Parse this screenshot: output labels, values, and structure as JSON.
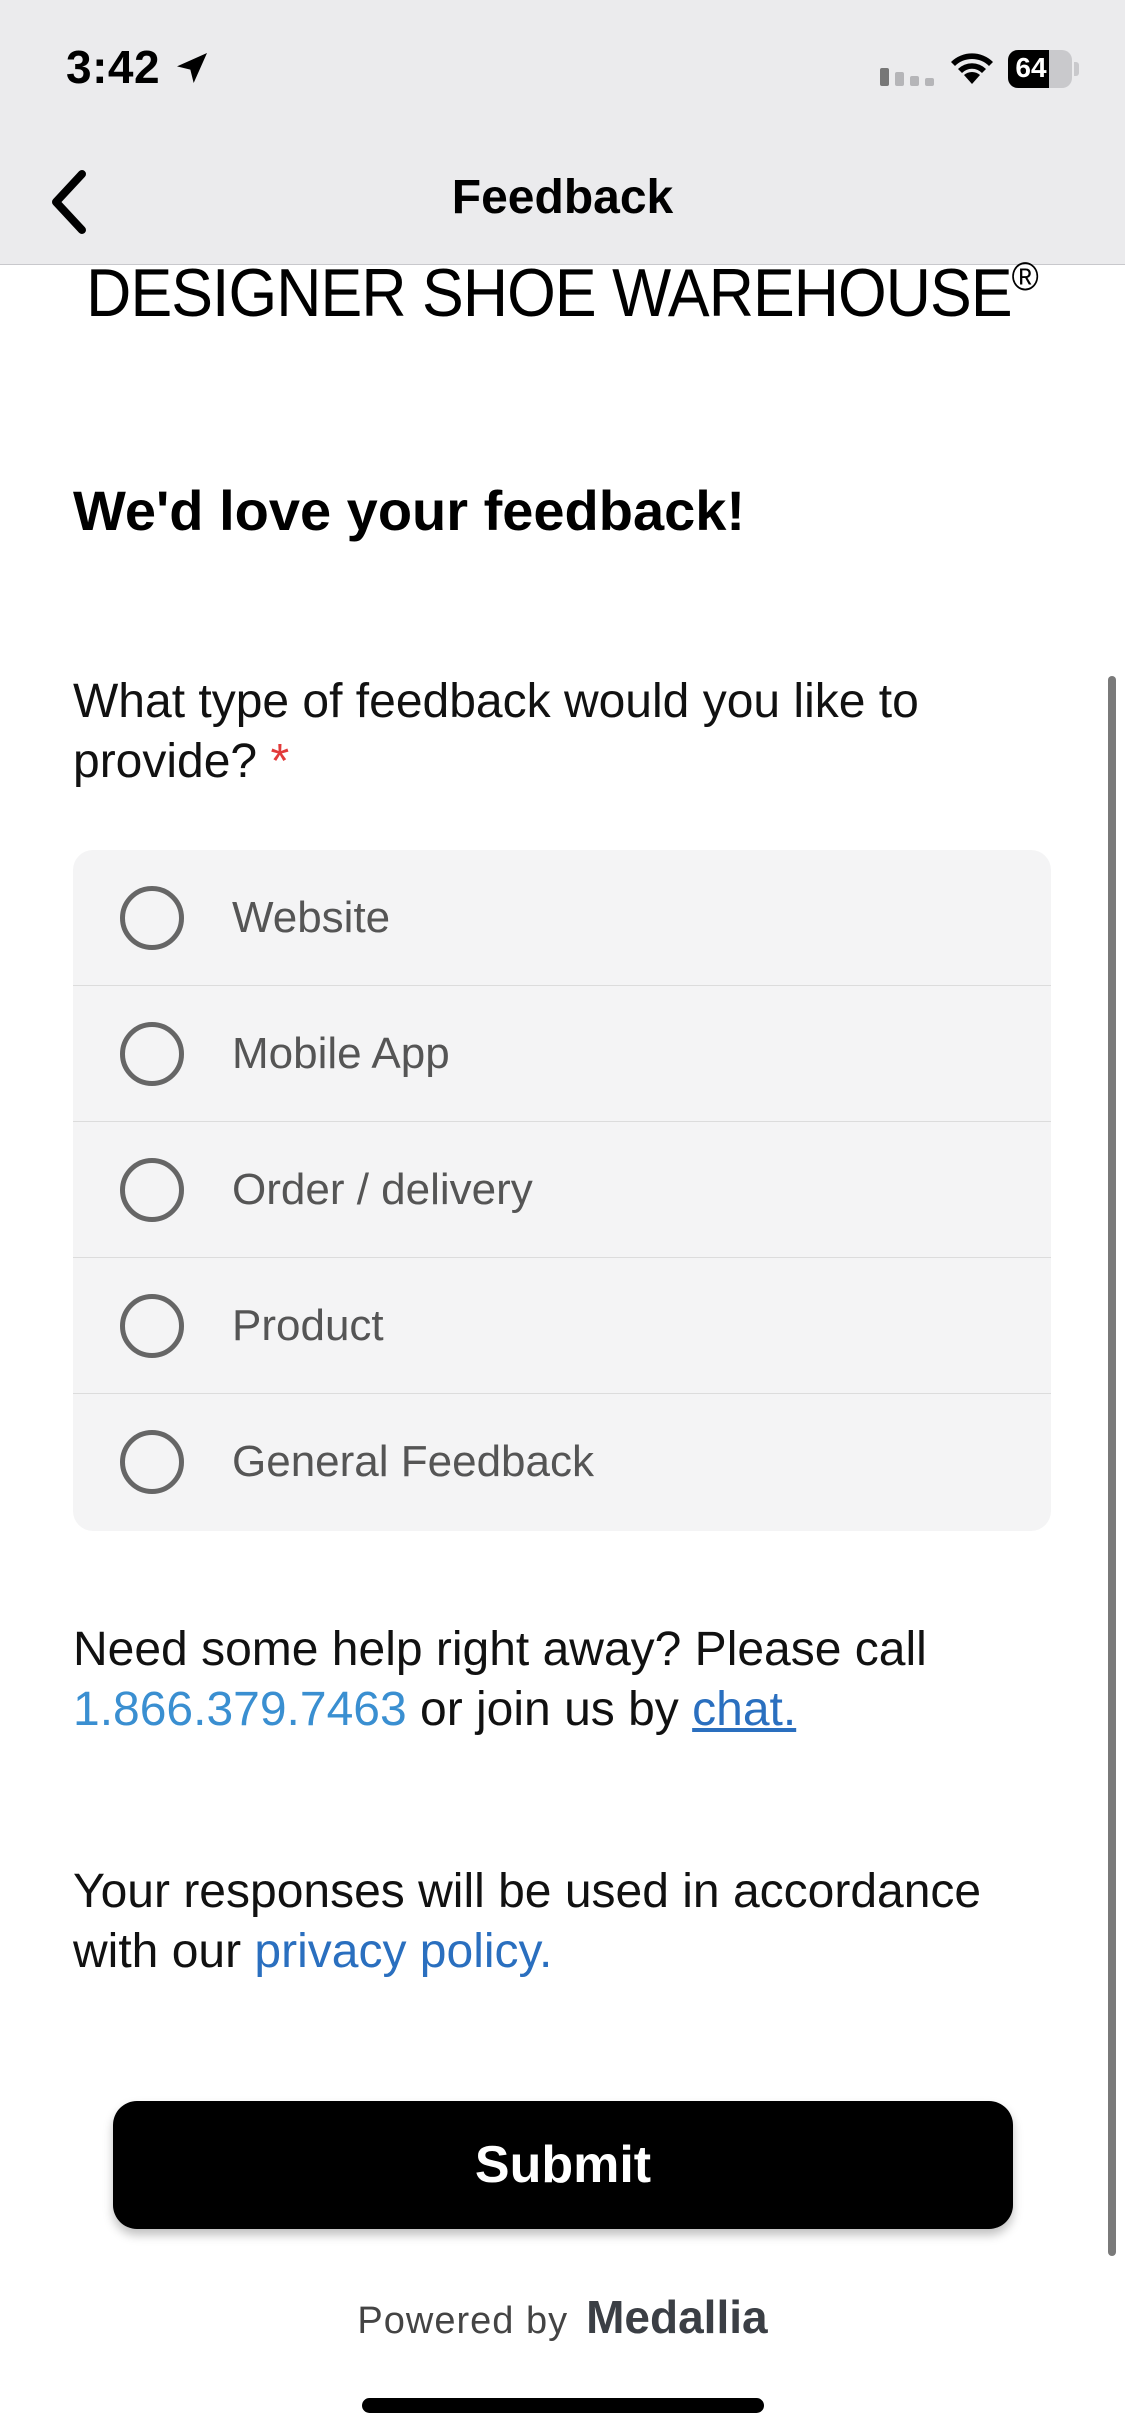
{
  "status_bar": {
    "time": "3:42",
    "battery_level": "64",
    "battery_fraction": 0.64
  },
  "nav": {
    "title": "Feedback"
  },
  "brand": {
    "name": "DESIGNER SHOE WAREHOUSE",
    "mark": "®"
  },
  "form": {
    "heading": "We'd love your feedback!",
    "question": "What type of feedback would you like to provide?",
    "required_marker": "*",
    "options": [
      {
        "label": "Website",
        "selected": false
      },
      {
        "label": "Mobile App",
        "selected": false
      },
      {
        "label": "Order / delivery",
        "selected": false
      },
      {
        "label": "Product",
        "selected": false
      },
      {
        "label": "General Feedback",
        "selected": false
      }
    ]
  },
  "help": {
    "prefix": "Need some help right away? Please call",
    "phone": "1.866.379.7463",
    "middle": "or join us by",
    "chat_link": "chat."
  },
  "privacy": {
    "prefix": "Your responses will be used in accordance with our",
    "link": "privacy policy."
  },
  "submit_label": "Submit",
  "footer": {
    "powered_by": "Powered by",
    "brand": "Medallia"
  },
  "colors": {
    "accent_link": "#3a8fd1",
    "required": "#e23a3a",
    "button": "#000000"
  }
}
